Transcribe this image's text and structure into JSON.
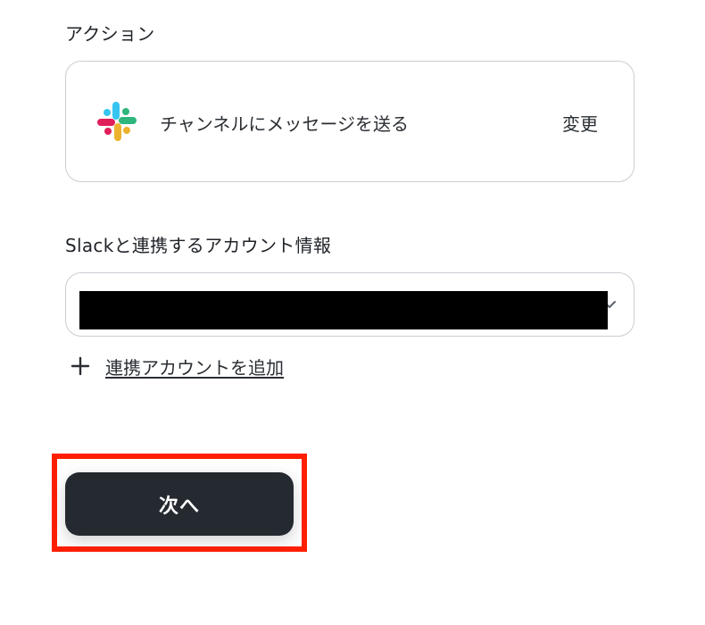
{
  "action": {
    "section_label": "アクション",
    "app_icon": "slack-icon",
    "name": "チャンネルにメッセージを送る",
    "change_label": "変更"
  },
  "account": {
    "section_label": "Slackと連携するアカウント情報",
    "selected_value": "",
    "add_label": "連携アカウントを追加"
  },
  "footer": {
    "next_label": "次へ"
  },
  "colors": {
    "primary_button": "#252a31",
    "highlight": "#ff1f00",
    "border": "#c9cdd2",
    "slack": [
      "#36C5F0",
      "#2EB67D",
      "#ECB22E",
      "#E01E5A"
    ]
  }
}
